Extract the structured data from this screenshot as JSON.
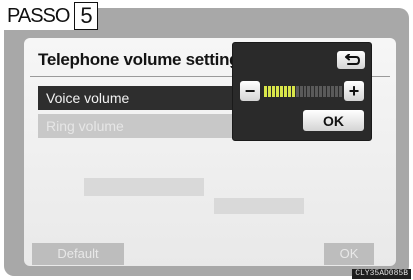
{
  "step": {
    "word": "PASSO",
    "number": "5"
  },
  "screen": {
    "title": "Telephone volume setting:",
    "rows": [
      {
        "label": "Voice volume",
        "state": "selected"
      },
      {
        "label": "Ring volume",
        "state": "disabled"
      }
    ],
    "bottom_buttons": {
      "default_label": "Default",
      "ok_label": "OK"
    }
  },
  "popup": {
    "back_icon": "return-arrow-icon",
    "minus_label": "−",
    "plus_label": "+",
    "ok_label": "OK",
    "volume": {
      "level": 8,
      "max": 20
    },
    "meter_on_color": "#d9e64a"
  },
  "caption": "CLY35AD085B"
}
